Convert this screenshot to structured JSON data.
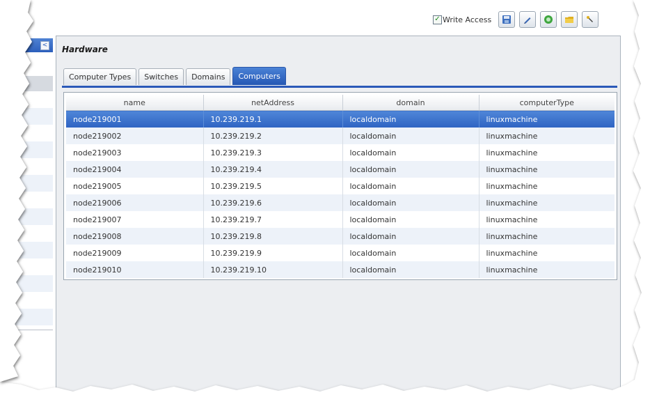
{
  "toolbar": {
    "write_access_label": "Write Access",
    "write_access_checked": true,
    "buttons": [
      {
        "icon": "save-icon",
        "color": "#3d6fbf"
      },
      {
        "icon": "pencil-icon",
        "color": "#3a68b5"
      },
      {
        "icon": "ok-circle-icon",
        "color": "#3fa63f"
      },
      {
        "icon": "folder-icon",
        "color": "#e0b020"
      },
      {
        "icon": "wrench-icon",
        "color": "#444444"
      }
    ]
  },
  "sidebar": {
    "collapse_symbol": "<"
  },
  "panel": {
    "title": "Hardware"
  },
  "tabs": [
    {
      "label": "Computer Types",
      "active": false
    },
    {
      "label": "Switches",
      "active": false
    },
    {
      "label": "Domains",
      "active": false
    },
    {
      "label": "Computers",
      "active": true
    }
  ],
  "grid": {
    "columns": [
      "name",
      "netAddress",
      "domain",
      "computerType"
    ],
    "rows": [
      {
        "name": "node219001",
        "netAddress": "10.239.219.1",
        "domain": "localdomain",
        "computerType": "linuxmachine",
        "selected": true
      },
      {
        "name": "node219002",
        "netAddress": "10.239.219.2",
        "domain": "localdomain",
        "computerType": "linuxmachine"
      },
      {
        "name": "node219003",
        "netAddress": "10.239.219.3",
        "domain": "localdomain",
        "computerType": "linuxmachine"
      },
      {
        "name": "node219004",
        "netAddress": "10.239.219.4",
        "domain": "localdomain",
        "computerType": "linuxmachine"
      },
      {
        "name": "node219005",
        "netAddress": "10.239.219.5",
        "domain": "localdomain",
        "computerType": "linuxmachine"
      },
      {
        "name": "node219006",
        "netAddress": "10.239.219.6",
        "domain": "localdomain",
        "computerType": "linuxmachine"
      },
      {
        "name": "node219007",
        "netAddress": "10.239.219.7",
        "domain": "localdomain",
        "computerType": "linuxmachine"
      },
      {
        "name": "node219008",
        "netAddress": "10.239.219.8",
        "domain": "localdomain",
        "computerType": "linuxmachine"
      },
      {
        "name": "node219009",
        "netAddress": "10.239.219.9",
        "domain": "localdomain",
        "computerType": "linuxmachine"
      },
      {
        "name": "node219010",
        "netAddress": "10.239.219.10",
        "domain": "localdomain",
        "computerType": "linuxmachine"
      }
    ]
  },
  "colors": {
    "accent": "#2e63c2",
    "row_alt": "#edf2f9",
    "panel_bg": "#eceef1"
  }
}
